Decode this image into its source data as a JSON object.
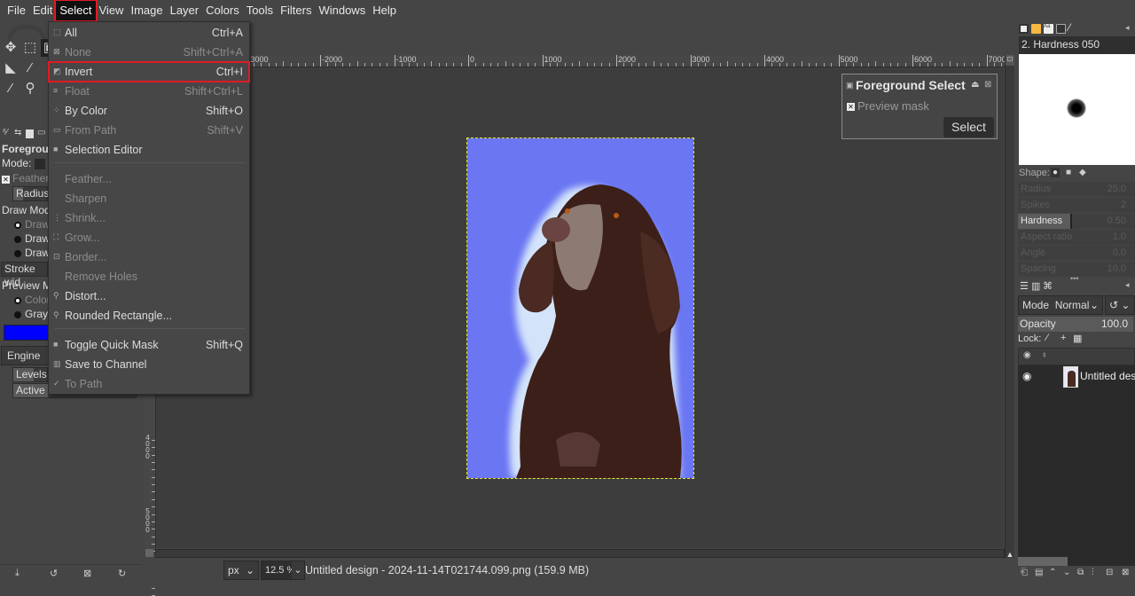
{
  "menubar": {
    "items": [
      "File",
      "Edit",
      "Select",
      "View",
      "Image",
      "Layer",
      "Colors",
      "Tools",
      "Filters",
      "Windows",
      "Help"
    ],
    "active": "Select"
  },
  "select_menu": {
    "items": [
      {
        "label": "All",
        "shortcut": "Ctrl+A",
        "enabled": true,
        "icon": "select-all-icon"
      },
      {
        "label": "None",
        "shortcut": "Shift+Ctrl+A",
        "enabled": false,
        "icon": "select-none-icon"
      },
      {
        "label": "Invert",
        "shortcut": "Ctrl+I",
        "enabled": true,
        "icon": "invert-icon",
        "highlighted": true
      },
      {
        "label": "Float",
        "shortcut": "Shift+Ctrl+L",
        "enabled": false,
        "icon": "float-icon"
      },
      {
        "label": "By Color",
        "shortcut": "Shift+O",
        "enabled": true,
        "icon": "by-color-icon"
      },
      {
        "label": "From Path",
        "shortcut": "Shift+V",
        "enabled": false,
        "icon": "from-path-icon"
      },
      {
        "label": "Selection Editor",
        "shortcut": "",
        "enabled": true,
        "icon": "selection-editor-icon"
      },
      {
        "label": "Feather...",
        "shortcut": "",
        "enabled": false,
        "icon": ""
      },
      {
        "label": "Sharpen",
        "shortcut": "",
        "enabled": false,
        "icon": ""
      },
      {
        "label": "Shrink...",
        "shortcut": "",
        "enabled": false,
        "icon": "shrink-icon"
      },
      {
        "label": "Grow...",
        "shortcut": "",
        "enabled": false,
        "icon": "grow-icon"
      },
      {
        "label": "Border...",
        "shortcut": "",
        "enabled": false,
        "icon": "border-icon"
      },
      {
        "label": "Remove Holes",
        "shortcut": "",
        "enabled": false,
        "icon": ""
      },
      {
        "label": "Distort...",
        "shortcut": "",
        "enabled": true,
        "icon": "script-icon"
      },
      {
        "label": "Rounded Rectangle...",
        "shortcut": "",
        "enabled": true,
        "icon": "script-icon"
      },
      {
        "label": "Toggle Quick Mask",
        "shortcut": "Shift+Q",
        "enabled": true,
        "icon": "quick-mask-icon"
      },
      {
        "label": "Save to Channel",
        "shortcut": "",
        "enabled": true,
        "icon": "channel-icon"
      },
      {
        "label": "To Path",
        "shortcut": "",
        "enabled": false,
        "icon": "path-icon"
      }
    ]
  },
  "tool_options": {
    "title": "Foregroun",
    "mode_label": "Mode:",
    "feather_label": "Feather",
    "radius_label": "Radius",
    "draw_mode_label": "Draw Mode",
    "draw_options": [
      "Draw",
      "Draw",
      "Draw"
    ],
    "stroke_width_label": "Stroke wid",
    "preview_mode_label": "Preview Mo",
    "preview_options": [
      "Color",
      "Grays"
    ],
    "mask_color": "#0000ff",
    "engine_label": "Engine",
    "levels_label": "Levels",
    "active_levels_label": "Active le"
  },
  "rulers": {
    "h_labels": [
      "-3000",
      "-2000",
      "-1000",
      "0",
      "1000",
      "2000",
      "3000",
      "4000",
      "5000",
      "6000",
      "7000"
    ],
    "v_labels": [
      "4000",
      "5000"
    ]
  },
  "fg_select_dialog": {
    "title": "Foreground Select",
    "preview_mask_label": "Preview mask",
    "select_button": "Select"
  },
  "statusbar": {
    "unit": "px",
    "zoom": "12.5 %",
    "title": "Untitled design - 2024-11-14T021744.099.png (159.9 MB)"
  },
  "brushes": {
    "brush_name": "2. Hardness 050",
    "shape_label": "Shape:",
    "params": [
      {
        "label": "Radius",
        "value": "25.0",
        "active": false
      },
      {
        "label": "Spikes",
        "value": "2",
        "active": false
      },
      {
        "label": "Hardness",
        "value": "0.50",
        "active": true
      },
      {
        "label": "Aspect ratio",
        "value": "1.0",
        "active": false
      },
      {
        "label": "Angle",
        "value": "0.0",
        "active": false
      },
      {
        "label": "Spacing",
        "value": "10.0",
        "active": false
      }
    ]
  },
  "layers": {
    "mode_label": "Mode",
    "mode_value": "Normal",
    "opacity_label": "Opacity",
    "opacity_value": "100.0",
    "lock_label": "Lock:",
    "layer_name": "Untitled desi"
  },
  "colors": {
    "image_bg": "#6a76f2",
    "highlight": "#e01b24"
  }
}
